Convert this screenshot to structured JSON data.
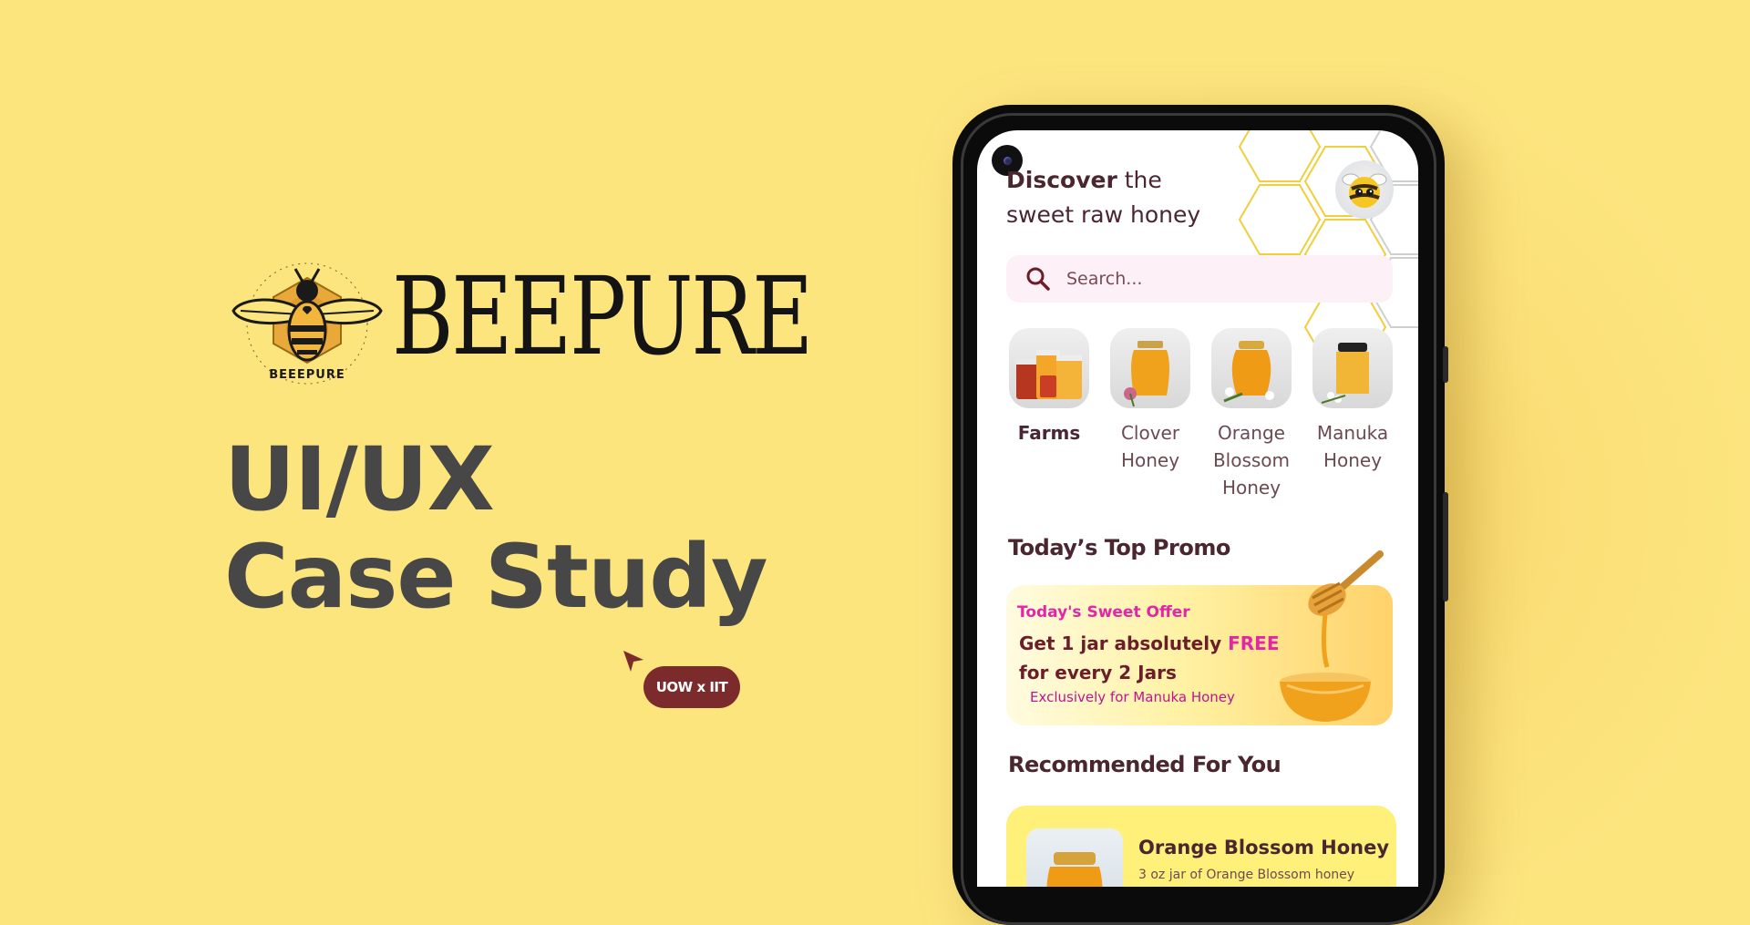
{
  "brand": {
    "name": "BEEPURE",
    "logo_ring_text": "BEEEPURE"
  },
  "hero": {
    "line1": "UI/UX",
    "line2": "Case Study",
    "tag": "UOW x IIT"
  },
  "app": {
    "heading_bold": "Discover",
    "heading_rest_line1": " the",
    "heading_line2": "sweet raw honey",
    "search": {
      "placeholder": "Search..."
    },
    "categories": [
      {
        "label": "Farms",
        "active": true
      },
      {
        "label": "Clover Honey",
        "active": false
      },
      {
        "label": "Orange Blossom Honey",
        "active": false
      },
      {
        "label": "Manuka Honey",
        "active": false
      }
    ],
    "promo_section_title": "Today’s Top Promo",
    "promo": {
      "kicker": "Today's Sweet Offer",
      "line1_prefix": "Get 1 jar absolutely ",
      "line1_highlight": "FREE",
      "line2": "for every 2 Jars",
      "note": "Exclusively for Manuka Honey"
    },
    "recommended_section_title": "Recommended For You",
    "recommended": [
      {
        "name": "Orange Blossom Honey",
        "desc": "3 oz jar of Orange Blossom honey"
      }
    ]
  },
  "colors": {
    "background": "#fde57e",
    "title_text": "#474747",
    "tag_bg": "#7b2b2b",
    "app_text": "#4a2630",
    "promo_accent": "#e226a6"
  }
}
